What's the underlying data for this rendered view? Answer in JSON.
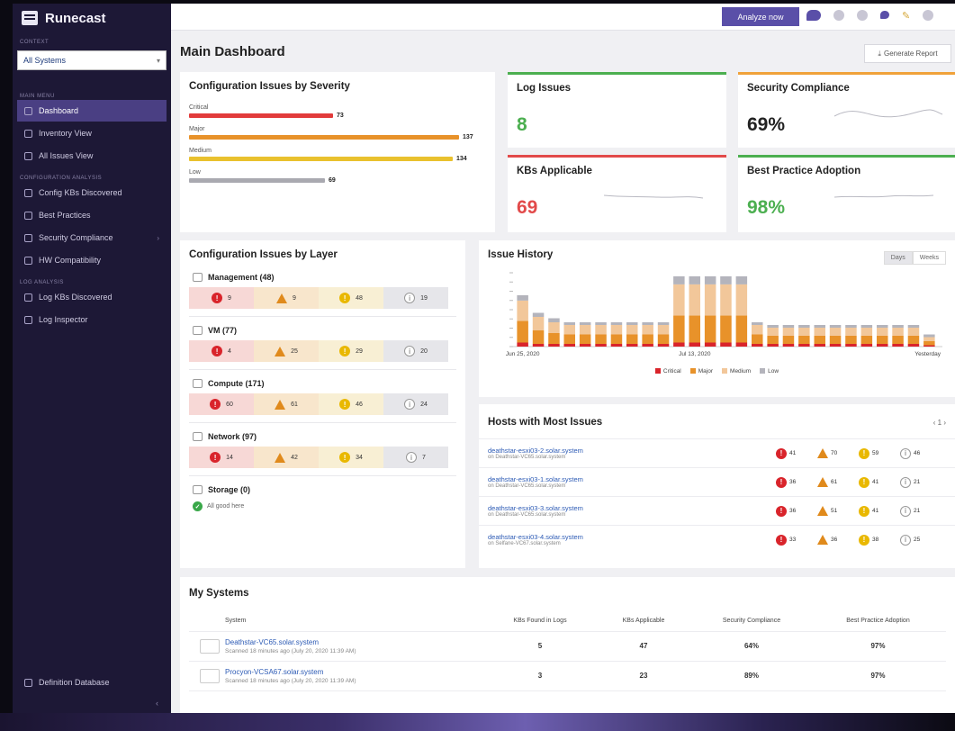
{
  "app": {
    "logo": "Runecast"
  },
  "sidebar": {
    "context_caption": "CONTEXT",
    "context_value": "All Systems",
    "main_caption": "MAIN MENU",
    "main_items": [
      {
        "label": "Dashboard",
        "icon": "home-icon",
        "active": true
      },
      {
        "label": "Inventory View",
        "icon": "inventory-icon"
      },
      {
        "label": "All Issues View",
        "icon": "issues-icon"
      }
    ],
    "config_caption": "CONFIGURATION ANALYSIS",
    "config_items": [
      {
        "label": "Config KBs Discovered",
        "icon": "kb-icon"
      },
      {
        "label": "Best Practices",
        "icon": "check-icon"
      },
      {
        "label": "Security Compliance",
        "icon": "shield-icon",
        "arrow": "›"
      },
      {
        "label": "HW Compatibility",
        "icon": "hardware-icon"
      }
    ],
    "log_caption": "LOG ANALYSIS",
    "log_items": [
      {
        "label": "Log KBs Discovered",
        "icon": "log-kb-icon"
      },
      {
        "label": "Log Inspector",
        "icon": "log-inspector-icon"
      }
    ],
    "bottom_item": "Definition Database",
    "collapse_glyph": "‹"
  },
  "topbar": {
    "analyze_label": "Analyze now"
  },
  "main": {
    "title": "Main Dashboard",
    "generate_label": "Generate Report"
  },
  "severity": {
    "title": "Configuration Issues by Severity",
    "rows": [
      {
        "label": "Critical",
        "value": 73,
        "color": "#e23b3b"
      },
      {
        "label": "Major",
        "value": 137,
        "color": "#e8922a"
      },
      {
        "label": "Medium",
        "value": 134,
        "color": "#e9c12e"
      },
      {
        "label": "Low",
        "value": 69,
        "color": "#a9a9b0"
      }
    ],
    "max": 137
  },
  "kpis": [
    {
      "title": "Log Issues",
      "value": "8",
      "color": "#4caf50"
    },
    {
      "title": "Security Compliance",
      "value": "69%",
      "color": "#f0a23a",
      "value_color": "#222"
    },
    {
      "title": "KBs Applicable",
      "value": "69",
      "color": "#e24a4a"
    },
    {
      "title": "Best Practice Adoption",
      "value": "98%",
      "color": "#4caf50"
    }
  ],
  "layers": {
    "title": "Configuration Issues by Layer",
    "items": [
      {
        "name": "Management (48)",
        "icon": "management-icon",
        "counts": [
          "9",
          "9",
          "48",
          "19"
        ]
      },
      {
        "name": "VM (77)",
        "icon": "vm-icon",
        "counts": [
          "4",
          "25",
          "29",
          "20"
        ]
      },
      {
        "name": "Compute (171)",
        "icon": "compute-icon",
        "counts": [
          "60",
          "61",
          "46",
          "24"
        ]
      },
      {
        "name": "Network (97)",
        "icon": "network-icon",
        "counts": [
          "14",
          "42",
          "34",
          "7"
        ]
      }
    ],
    "storage": {
      "name": "Storage (0)",
      "ok_text": "All good here"
    }
  },
  "history": {
    "title": "Issue History",
    "toggle": [
      "Days",
      "Weeks"
    ],
    "x_labels": [
      "Jun 25, 2020",
      "Jul 13, 2020",
      "Yesterday"
    ],
    "legend": [
      "Critical",
      "Major",
      "Medium",
      "Low"
    ]
  },
  "chart_data": {
    "type": "bar",
    "title": "Issue History",
    "stacked": true,
    "categories": [
      "1",
      "2",
      "3",
      "4",
      "5",
      "6",
      "7",
      "8",
      "9",
      "10",
      "11",
      "12",
      "13",
      "14",
      "15",
      "16",
      "17",
      "18",
      "19",
      "20",
      "21",
      "22",
      "23",
      "24",
      "25",
      "26",
      "27"
    ],
    "series": [
      {
        "name": "Critical",
        "color": "#d9242b",
        "values": [
          3,
          2,
          2,
          2,
          2,
          2,
          2,
          2,
          2,
          2,
          3,
          3,
          3,
          3,
          3,
          2,
          2,
          2,
          2,
          2,
          2,
          2,
          2,
          2,
          2,
          2,
          1
        ]
      },
      {
        "name": "Major",
        "color": "#e8922a",
        "values": [
          16,
          10,
          8,
          7,
          7,
          7,
          7,
          7,
          7,
          7,
          20,
          20,
          20,
          20,
          20,
          7,
          6,
          6,
          6,
          6,
          6,
          6,
          6,
          6,
          6,
          6,
          3
        ]
      },
      {
        "name": "Medium",
        "color": "#f2c79a",
        "values": [
          15,
          10,
          8,
          7,
          7,
          7,
          7,
          7,
          7,
          7,
          23,
          23,
          23,
          23,
          23,
          7,
          6,
          6,
          6,
          6,
          6,
          6,
          6,
          6,
          6,
          6,
          3
        ]
      },
      {
        "name": "Low",
        "color": "#b4b4bc",
        "values": [
          4,
          3,
          3,
          2,
          2,
          2,
          2,
          2,
          2,
          2,
          6,
          6,
          6,
          6,
          6,
          2,
          2,
          2,
          2,
          2,
          2,
          2,
          2,
          2,
          2,
          2,
          2
        ]
      }
    ]
  },
  "hosts": {
    "title": "Hosts with Most Issues",
    "pager": "‹ 1 ›",
    "rows": [
      {
        "name": "deathstar-esxi03-2.solar.system",
        "sub": "on Deathstar-VC65.solar.system",
        "counts": [
          "41",
          "70",
          "59",
          "46"
        ]
      },
      {
        "name": "deathstar-esxi03-1.solar.system",
        "sub": "on Deathstar-VC65.solar.system",
        "counts": [
          "36",
          "61",
          "41",
          "21"
        ]
      },
      {
        "name": "deathstar-esxi03-3.solar.system",
        "sub": "on Deathstar-VC65.solar.system",
        "counts": [
          "36",
          "51",
          "41",
          "21"
        ]
      },
      {
        "name": "deathstar-esxi03-4.solar.system",
        "sub": "on Selfane-VC67.solar.system",
        "counts": [
          "33",
          "36",
          "38",
          "25"
        ]
      }
    ]
  },
  "systems": {
    "title": "My Systems",
    "headers": [
      "System",
      "KBs Found in Logs",
      "KBs Applicable",
      "Security Compliance",
      "Best Practice Adoption"
    ],
    "rows": [
      {
        "name": "Deathstar-VC65.solar.system",
        "scanned": "Scanned 18 minutes ago (July 20, 2020 11:39 AM)",
        "kbs_logs": "5",
        "kbs_applicable": "47",
        "security": "64%",
        "best_practice": "97%"
      },
      {
        "name": "Procyon-VCSA67.solar.system",
        "scanned": "Scanned 18 minutes ago (July 20, 2020 11:39 AM)",
        "kbs_logs": "3",
        "kbs_applicable": "23",
        "security": "89%",
        "best_practice": "97%"
      }
    ]
  }
}
